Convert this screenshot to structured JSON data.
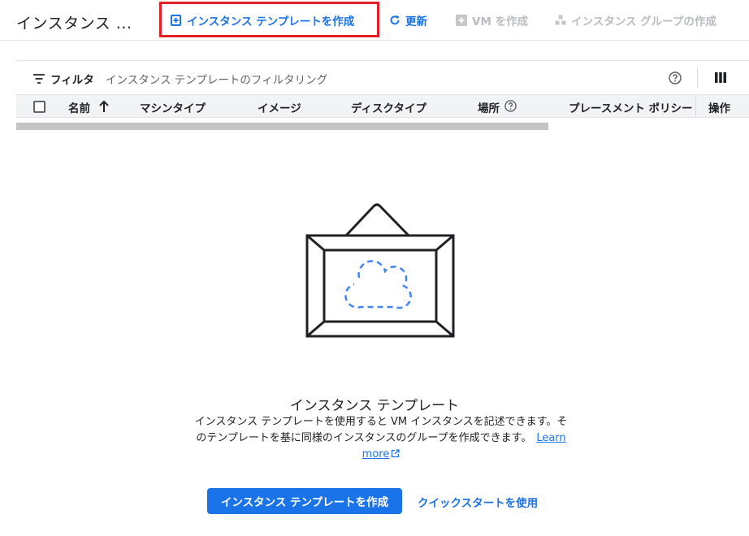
{
  "header": {
    "title": "インスタンス ...",
    "actions": {
      "create_template": "インスタンス テンプレートを作成",
      "refresh": "更新",
      "create_vm": "VM を作成",
      "create_group": "インスタンス グループの作成"
    }
  },
  "filter": {
    "label": "フィルタ",
    "placeholder": "インスタンス テンプレートのフィルタリング"
  },
  "table": {
    "columns": [
      "名前",
      "マシンタイプ",
      "イメージ",
      "ディスクタイプ",
      "場所",
      "プレースメント ポリシー",
      "操作"
    ]
  },
  "empty_state": {
    "title": "インスタンス テンプレート",
    "description": "インスタンス テンプレートを使用すると VM インスタンスを記述できます。そのテンプレートを基に同様のインスタンスのグループを作成できます。",
    "learn_more": "Learn more",
    "primary_button": "インスタンス テンプレートを作成",
    "secondary_button": "クイックスタートを使用"
  },
  "colors": {
    "accent": "#1a73e8",
    "highlight": "#e41e26",
    "disabled": "#b9bcc0"
  },
  "icons": [
    "add-box-icon",
    "refresh-icon",
    "add-icon",
    "group-icon",
    "filter-icon",
    "help-icon",
    "columns-icon",
    "sort-up-icon",
    "external-link-icon"
  ]
}
